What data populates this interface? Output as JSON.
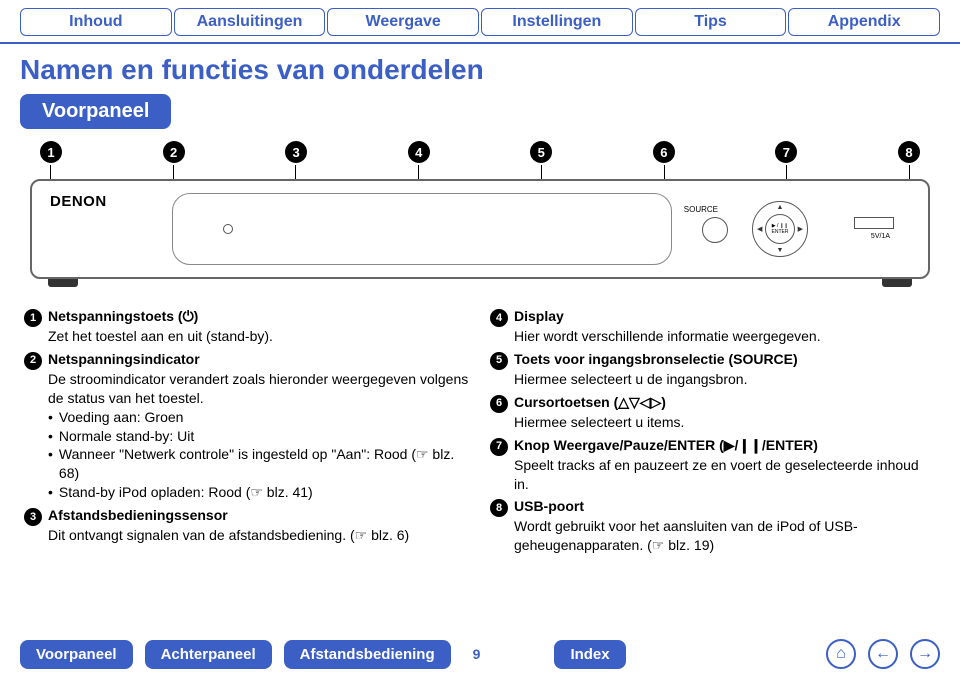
{
  "tabs": [
    "Inhoud",
    "Aansluitingen",
    "Weergave",
    "Instellingen",
    "Tips",
    "Appendix"
  ],
  "page_title": "Namen en functies van onderdelen",
  "section_label": "Voorpaneel",
  "device": {
    "brand": "DENON",
    "source_label": "SOURCE",
    "enter_label": "▶ / ❙❙\nENTER",
    "usb_label": "5V/1A"
  },
  "callout_numbers": [
    "1",
    "2",
    "3",
    "4",
    "5",
    "6",
    "7",
    "8"
  ],
  "left_items": [
    {
      "num": "1",
      "title": "Netspanningstoets (⏻)",
      "body": "Zet het toestel aan en uit (stand-by)."
    },
    {
      "num": "2",
      "title": "Netspanningsindicator",
      "body": "De stroomindicator verandert zoals hieronder weergegeven volgens de status van het toestel.",
      "bullets": [
        "Voeding aan: Groen",
        "Normale stand-by: Uit",
        "Wanneer \"Netwerk controle\" is ingesteld op \"Aan\": Rood (☞ blz. 68)",
        "Stand-by iPod opladen: Rood (☞ blz. 41)"
      ]
    },
    {
      "num": "3",
      "title": "Afstandsbedieningssensor",
      "body": "Dit ontvangt signalen van de afstandsbediening. (☞ blz. 6)"
    }
  ],
  "right_items": [
    {
      "num": "4",
      "title": "Display",
      "body": "Hier wordt verschillende informatie weergegeven."
    },
    {
      "num": "5",
      "title": "Toets voor ingangsbronselectie (SOURCE)",
      "body": "Hiermee selecteert u de ingangsbron."
    },
    {
      "num": "6",
      "title": "Cursortoetsen (△▽◁▷)",
      "body": "Hiermee selecteert u items."
    },
    {
      "num": "7",
      "title": "Knop Weergave/Pauze/ENTER (▶/❙❙/ENTER)",
      "body": "Speelt tracks af en pauzeert ze en voert de geselecteerde inhoud in."
    },
    {
      "num": "8",
      "title": "USB-poort",
      "body": "Wordt gebruikt voor het aansluiten van de iPod of USB-geheugenapparaten. (☞ blz. 19)"
    }
  ],
  "footer": {
    "buttons": [
      "Voorpaneel",
      "Achterpaneel",
      "Afstandsbediening"
    ],
    "page": "9",
    "index": "Index"
  }
}
